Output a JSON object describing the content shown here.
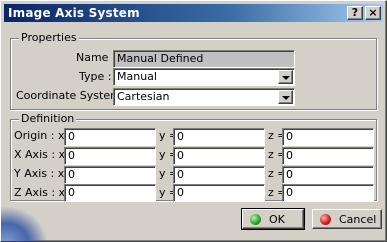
{
  "window": {
    "title": "Image Axis System",
    "help_label": "?",
    "close_label": "×"
  },
  "properties": {
    "legend": "Properties",
    "name_label": "Name :",
    "name_value": "Manual Defined",
    "type_label": "Type :",
    "type_value": "Manual",
    "coord_label": "Coordinate System :",
    "coord_value": "Cartesian"
  },
  "definition": {
    "legend": "Definition",
    "rows": [
      {
        "label": "Origin : x =",
        "x": "0",
        "y_label": "y =",
        "y": "0",
        "z_label": "z =",
        "z": "0"
      },
      {
        "label": "X Axis : x =",
        "x": "0",
        "y_label": "y =",
        "y": "0",
        "z_label": "z =",
        "z": "0"
      },
      {
        "label": "Y Axis : x =",
        "x": "0",
        "y_label": "y =",
        "y": "0",
        "z_label": "z =",
        "z": "0"
      },
      {
        "label": "Z Axis : x =",
        "x": "0",
        "y_label": "y =",
        "y": "0",
        "z_label": "z =",
        "z": "0"
      }
    ]
  },
  "buttons": {
    "ok_label": "OK",
    "cancel_label": "Cancel"
  }
}
